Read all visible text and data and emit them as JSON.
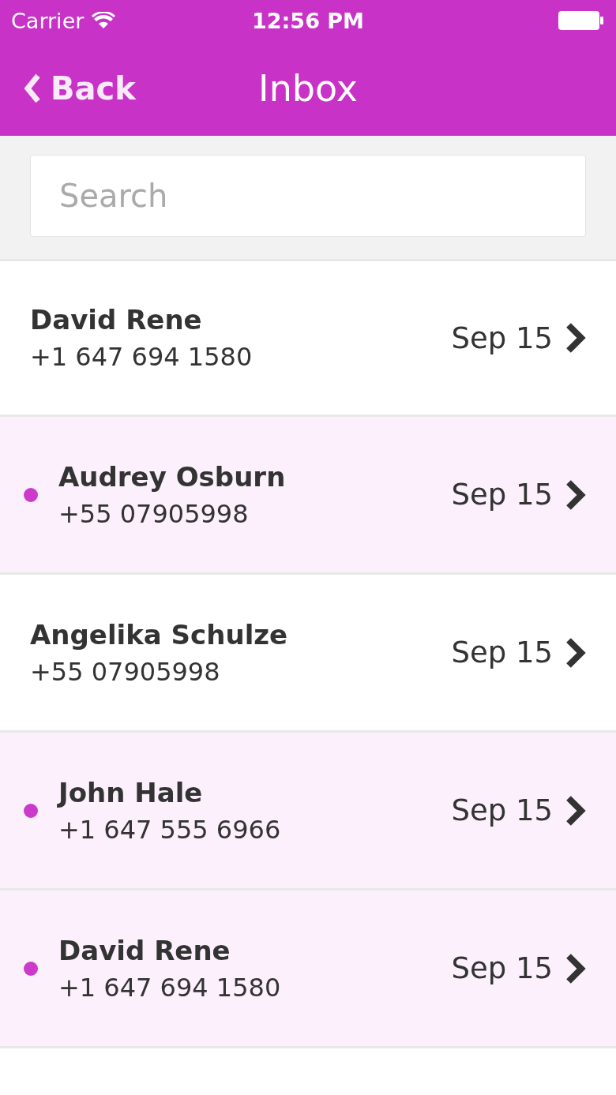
{
  "status_bar": {
    "carrier": "Carrier",
    "time": "12:56 PM"
  },
  "nav_bar": {
    "back": "Back",
    "title": "Inbox"
  },
  "search": {
    "placeholder": "Search"
  },
  "messages": [
    {
      "name": "David Rene",
      "phone": "+1 647 694 1580",
      "date": "Sep 15",
      "unread": false
    },
    {
      "name": "Audrey Osburn",
      "phone": "+55 07905998",
      "date": "Sep 15",
      "unread": true
    },
    {
      "name": "Angelika Schulze",
      "phone": "+55 07905998",
      "date": "Sep 15",
      "unread": false
    },
    {
      "name": "John Hale",
      "phone": "+1 647 555 6966",
      "date": "Sep 15",
      "unread": true
    },
    {
      "name": "David Rene",
      "phone": "+1 647 694 1580",
      "date": "Sep 15",
      "unread": true
    }
  ]
}
